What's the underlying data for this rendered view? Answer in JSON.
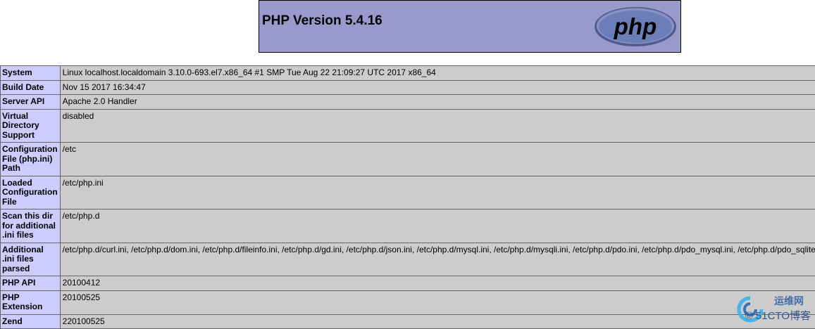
{
  "header": {
    "title": "PHP Version 5.4.16",
    "logo_text": "php",
    "colors": {
      "banner": "#9999cc",
      "logo_fill": "#6c7eb7",
      "logo_text": "#000000"
    }
  },
  "rows": [
    {
      "label": "System",
      "value": "Linux localhost.localdomain 3.10.0-693.el7.x86_64 #1 SMP Tue Aug 22 21:09:27 UTC 2017 x86_64"
    },
    {
      "label": "Build Date",
      "value": "Nov 15 2017 16:34:47"
    },
    {
      "label": "Server API",
      "value": "Apache 2.0 Handler"
    },
    {
      "label": "Virtual Directory Support",
      "value": "disabled"
    },
    {
      "label": "Configuration File (php.ini) Path",
      "value": "/etc"
    },
    {
      "label": "Loaded Configuration File",
      "value": "/etc/php.ini"
    },
    {
      "label": "Scan this dir for additional .ini files",
      "value": "/etc/php.d"
    },
    {
      "label": "Additional .ini files parsed",
      "value": "/etc/php.d/curl.ini, /etc/php.d/dom.ini, /etc/php.d/fileinfo.ini, /etc/php.d/gd.ini, /etc/php.d/json.ini, /etc/php.d/mysql.ini, /etc/php.d/mysqli.ini, /etc/php.d/pdo.ini, /etc/php.d/pdo_mysql.ini, /etc/php.d/pdo_sqlite"
    },
    {
      "label": "PHP API",
      "value": "20100412"
    },
    {
      "label": "PHP Extension",
      "value": "20100525"
    },
    {
      "label": "Zend",
      "value": "220100525"
    }
  ],
  "table_colors": {
    "label_bg": "#ccccff",
    "value_bg": "#cccccc"
  },
  "watermark": {
    "top": "运维网",
    "bottom": "© 51CTO博客",
    "icon": "swirl-logo-icon"
  }
}
